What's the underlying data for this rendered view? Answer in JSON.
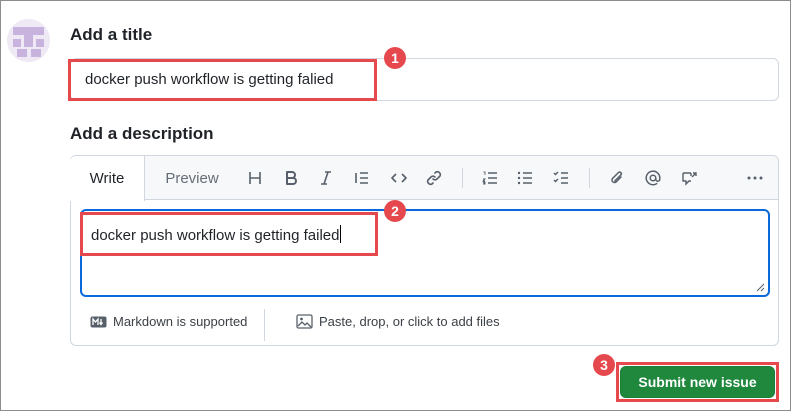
{
  "title_section": {
    "label": "Add a title",
    "value": "docker push workflow is getting falied"
  },
  "description_section": {
    "label": "Add a description",
    "tabs": [
      {
        "label": "Write",
        "active": true
      },
      {
        "label": "Preview",
        "active": false
      }
    ],
    "toolbar_icons": [
      "heading-icon",
      "bold-icon",
      "italic-icon",
      "quote-icon",
      "code-icon",
      "link-icon",
      "numbered-list-icon",
      "bulleted-list-icon",
      "task-list-icon",
      "attach-icon",
      "mention-icon",
      "reference-icon",
      "more-icon"
    ],
    "value": "docker push workflow is getting failed",
    "footer": {
      "markdown_label": "Markdown is supported",
      "files_label": "Paste, drop, or click to add files"
    }
  },
  "actions": {
    "submit_label": "Submit new issue"
  },
  "annotations": {
    "badges": [
      "1",
      "2",
      "3"
    ],
    "color": "#e5484d"
  },
  "colors": {
    "primary_button": "#1f883d",
    "focus_border": "#0969da",
    "border": "#d0d7de"
  }
}
